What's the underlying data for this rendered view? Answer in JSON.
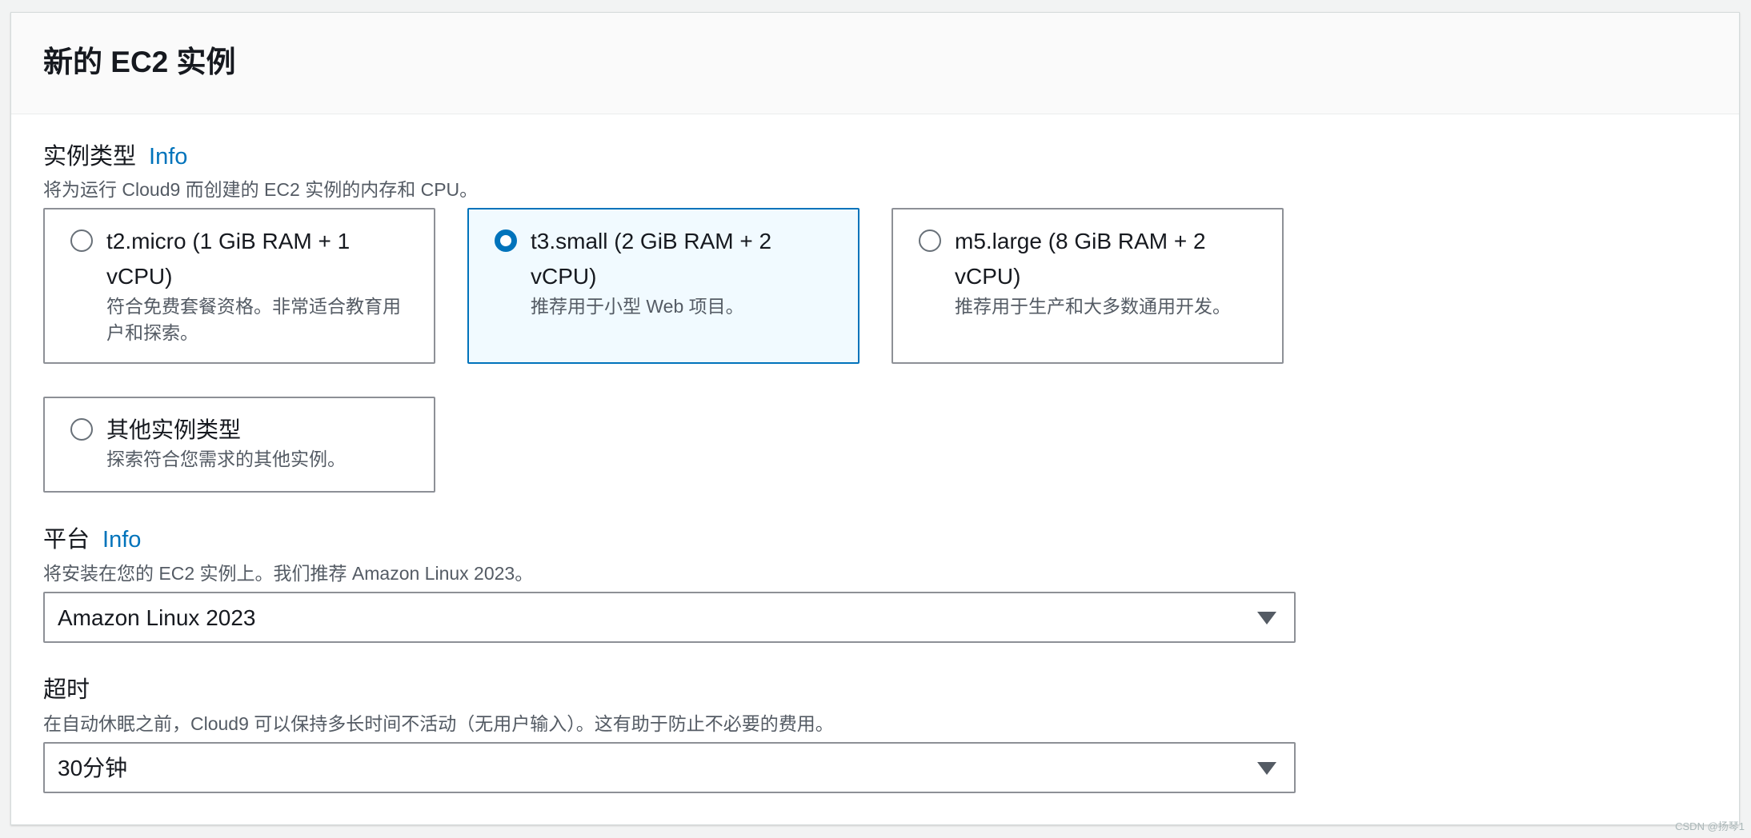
{
  "panel": {
    "title": "新的 EC2 实例"
  },
  "instance_type": {
    "label": "实例类型",
    "info": "Info",
    "description": "将为运行 Cloud9 而创建的 EC2 实例的内存和 CPU。",
    "options": [
      {
        "title": "t2.micro (1 GiB RAM + 1 vCPU)",
        "description": "符合免费套餐资格。非常适合教育用户和探索。",
        "selected": false
      },
      {
        "title": "t3.small (2 GiB RAM + 2 vCPU)",
        "description": "推荐用于小型 Web 项目。",
        "selected": true
      },
      {
        "title": "m5.large (8 GiB RAM + 2 vCPU)",
        "description": "推荐用于生产和大多数通用开发。",
        "selected": false
      },
      {
        "title": "其他实例类型",
        "description": "探索符合您需求的其他实例。",
        "selected": false
      }
    ]
  },
  "platform": {
    "label": "平台",
    "info": "Info",
    "description": "将安装在您的 EC2 实例上。我们推荐 Amazon Linux 2023。",
    "selected": "Amazon Linux 2023"
  },
  "timeout": {
    "label": "超时",
    "description": "在自动休眠之前，Cloud9 可以保持多长时间不活动（无用户输入）。这有助于防止不必要的费用。",
    "selected": "30分钟"
  },
  "watermark": "CSDN @扬琴1",
  "colors": {
    "accent": "#0073bb",
    "selected_bg": "#f1faff",
    "border": "#8d9096",
    "secondary_text": "#545b64"
  }
}
